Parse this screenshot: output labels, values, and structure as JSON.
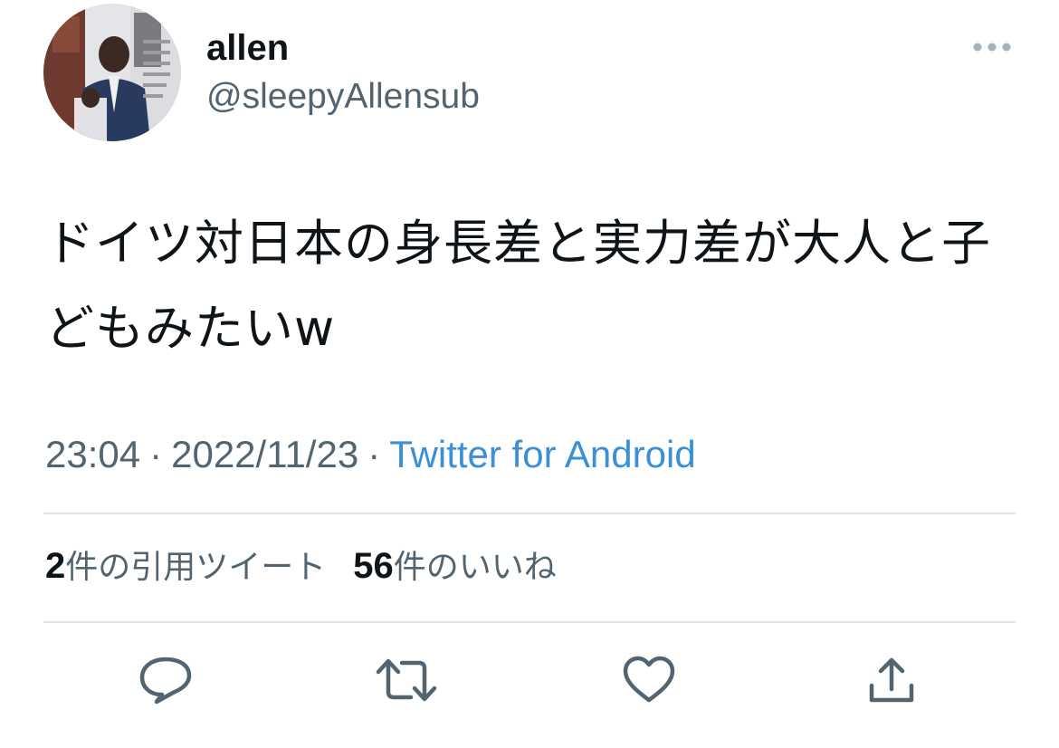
{
  "tweet": {
    "author": {
      "display_name": "allen",
      "handle": "@sleepyAllensub",
      "avatar": "profile-photo"
    },
    "text": "ドイツ対日本の身長差と実力差が大人と子どもみたいw",
    "time": "23:04",
    "date": "2022/11/23",
    "separator": "·",
    "source": "Twitter for Android"
  },
  "stats": {
    "quote_count": "2",
    "quote_label": "件の引用ツイート",
    "like_count": "56",
    "like_label": "件のいいね"
  },
  "icons": {
    "more": "more-horizontal-icon",
    "reply": "reply-icon",
    "retweet": "retweet-icon",
    "like": "heart-icon",
    "share": "share-icon"
  },
  "colors": {
    "text_primary": "#0f1419",
    "text_secondary": "#536471",
    "link": "#3a8fd6",
    "divider": "#dfe3e7"
  }
}
